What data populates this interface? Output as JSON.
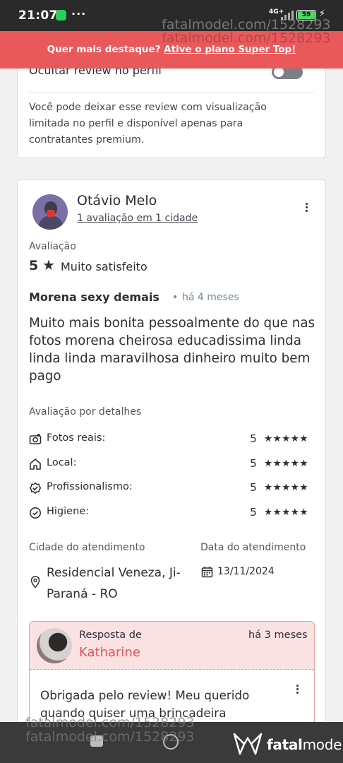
{
  "status_bar": {
    "time": "21:07",
    "menu_glyph": "···",
    "network": "4G+",
    "battery": "59",
    "charging_glyph": "⚡"
  },
  "promo": {
    "text": "Quer mais destaque?",
    "link": "Ative o plano Super Top!"
  },
  "watermark": {
    "text": "fatalmodel.com/1528293"
  },
  "privacy_card": {
    "toggle_label": "Ocultar review no perfil",
    "description": "Você pode deixar esse review com visualização limitada no perfil e disponível apenas para contratantes premium."
  },
  "review": {
    "reviewer_name": "Otávio Melo",
    "reviewer_sub": "1 avaliação em 1 cidade",
    "rating_label": "Avaliação",
    "rating_value": "5",
    "rating_star": "★",
    "rating_text": "Muito satisfeito",
    "title": "Morena sexy demais",
    "dot": "•",
    "time_ago": "há 4 meses",
    "body": "Muito mais bonita pessoalmente do que nas fotos morena cheirosa educadissima linda linda linda maravilhosa dinheiro muito bem pago",
    "details_label": "Avaliação por detalhes",
    "details": [
      {
        "label": "Fotos reais:",
        "value": "5",
        "stars": "★★★★★",
        "icon": "camera-icon"
      },
      {
        "label": "Local:",
        "value": "5",
        "stars": "★★★★★",
        "icon": "home-icon"
      },
      {
        "label": "Profissionalismo:",
        "value": "5",
        "stars": "★★★★★",
        "icon": "shield-check-icon"
      },
      {
        "label": "Higiene:",
        "value": "5",
        "stars": "★★★★★",
        "icon": "check-circle-icon"
      }
    ],
    "city_label": "Cidade do atendimento",
    "city_value": "Residencial Veneza, Ji-Paraná - RO",
    "date_label": "Data do atendimento",
    "date_value": "13/11/2024"
  },
  "reply": {
    "from_label": "Resposta de",
    "name": "Katharine",
    "time_ago": "há 3 meses",
    "body": "Obrigada pelo review! Meu querido quando quiser uma brincadeira"
  },
  "bottom_bar": {
    "brand_prefix": "fatal",
    "brand_suffix": "model"
  },
  "colors": {
    "promo_bg": "#e9595b",
    "accent": "#e2555a",
    "reply_bg": "#fbe2e2",
    "bottom_bar": "#3a3a3a"
  }
}
